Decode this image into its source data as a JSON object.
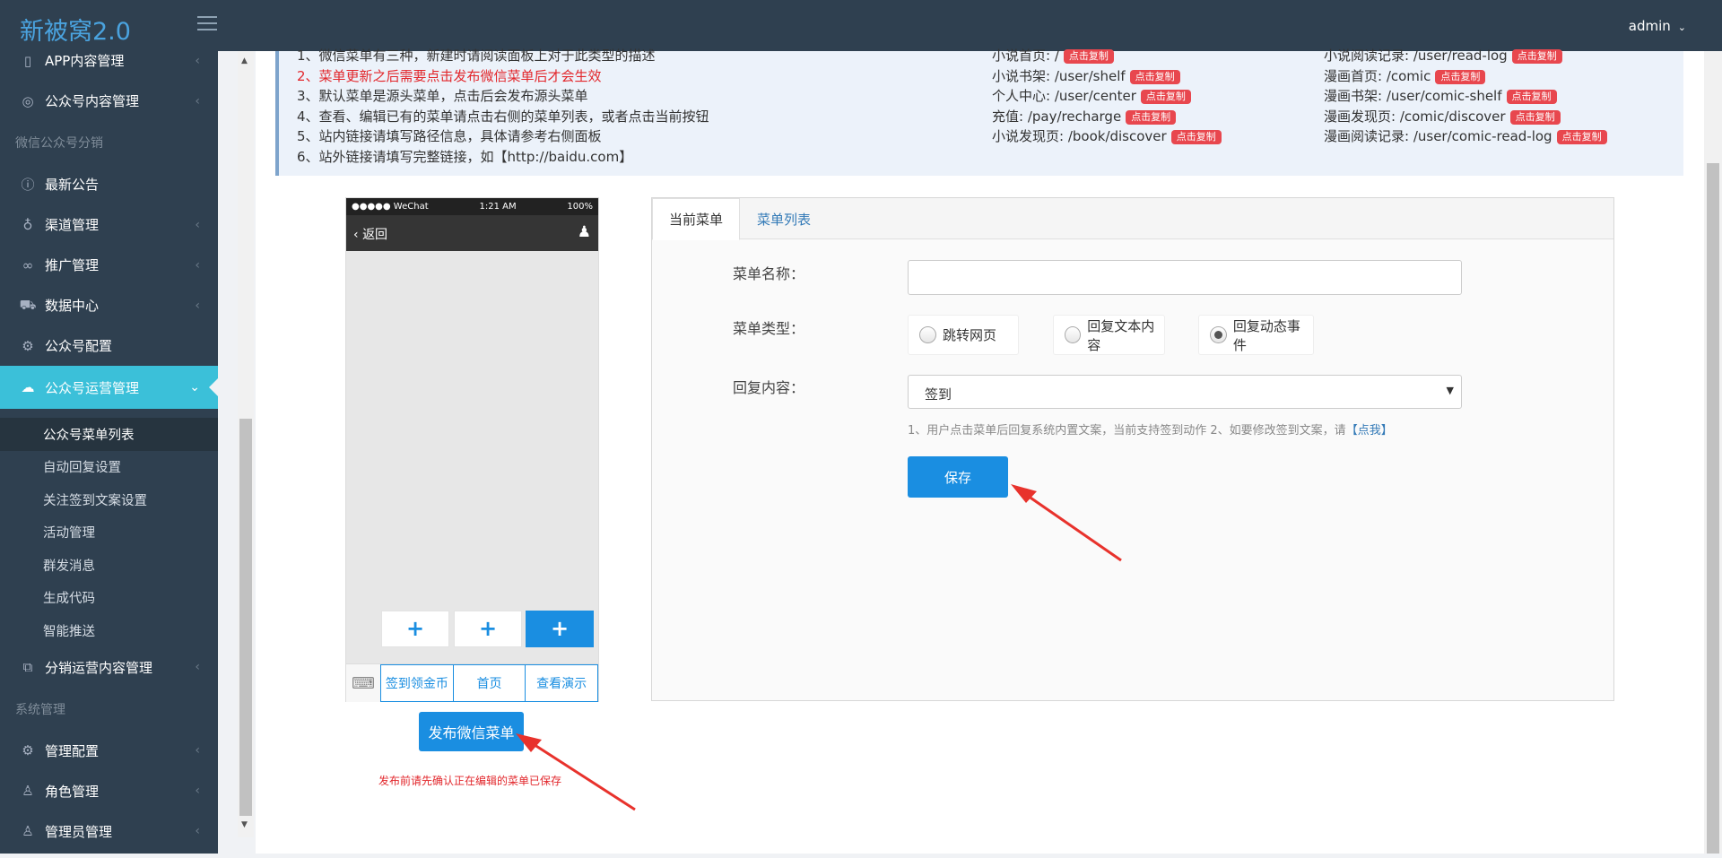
{
  "app_title": "新被窝2.0",
  "user": "admin",
  "sidebar": {
    "items": [
      {
        "label": "APP内容管理",
        "icon": "mobile-icon"
      },
      {
        "label": "公众号内容管理",
        "icon": "compass-icon"
      },
      {
        "group": "微信公众号分销"
      },
      {
        "label": "最新公告",
        "icon": "info-icon"
      },
      {
        "label": "渠道管理",
        "icon": "lightbulb-icon"
      },
      {
        "label": "推广管理",
        "icon": "link-icon"
      },
      {
        "label": "数据中心",
        "icon": "cart-icon"
      },
      {
        "label": "公众号配置",
        "icon": "gear-icon"
      },
      {
        "label": "公众号运营管理",
        "icon": "chat-icon",
        "active": true
      }
    ],
    "submenu": [
      "公众号菜单列表",
      "自动回复设置",
      "关注签到文案设置",
      "活动管理",
      "群发消息",
      "生成代码",
      "智能推送"
    ],
    "after_items": [
      {
        "label": "分销运营内容管理",
        "icon": "tags-icon"
      },
      {
        "group": "系统管理"
      },
      {
        "label": "管理配置",
        "icon": "gear-icon"
      },
      {
        "label": "角色管理",
        "icon": "user-icon"
      },
      {
        "label": "管理员管理",
        "icon": "users-icon"
      }
    ]
  },
  "notice": {
    "tips": [
      "1、微信菜单有三种，新建时请阅读面板上对于此类型的描述",
      "2、菜单更新之后需要点击发布微信菜单后才会生效",
      "3、默认菜单是源头菜单，点击后会发布源头菜单",
      "4、查看、编辑已有的菜单请点击右侧的菜单列表，或者点击当前按钮",
      "5、站内链接请填写路径信息，具体请参考右侧面板",
      "6、站外链接请填写完整链接，如【http://baidu.com】"
    ],
    "copy_label": "点击复制",
    "links_col1": [
      "小说首页: /",
      "小说书架: /user/shelf",
      "个人中心: /user/center",
      "充值: /pay/recharge",
      "小说发现页: /book/discover"
    ],
    "links_col2": [
      "小说阅读记录: /user/read-log",
      "漫画首页: /comic",
      "漫画书架: /user/comic-shelf",
      "漫画发现页: /comic/discover",
      "漫画阅读记录: /user/comic-read-log"
    ]
  },
  "phone": {
    "carrier": "●●●●● WeChat",
    "time": "1:21 AM",
    "battery": "100%",
    "back_label": "返回",
    "menu_items": [
      "签到领金币",
      "首页",
      "查看演示"
    ],
    "plus": "+"
  },
  "publish_button": "发布微信菜单",
  "publish_note": "发布前请先确认正在编辑的菜单已保存",
  "panel": {
    "tabs": [
      "当前菜单",
      "菜单列表"
    ],
    "name_label": "菜单名称：",
    "name_value": "",
    "type_label": "菜单类型：",
    "type_options": [
      "跳转网页",
      "回复文本内容",
      "回复动态事件"
    ],
    "type_selected": "回复动态事件",
    "reply_label": "回复内容：",
    "reply_value": "签到",
    "help_text": "1、用户点击菜单后回复系统内置文案，当前支持签到动作 2、如要修改签到文案，请",
    "help_link": "【点我】",
    "save_label": "保存"
  }
}
